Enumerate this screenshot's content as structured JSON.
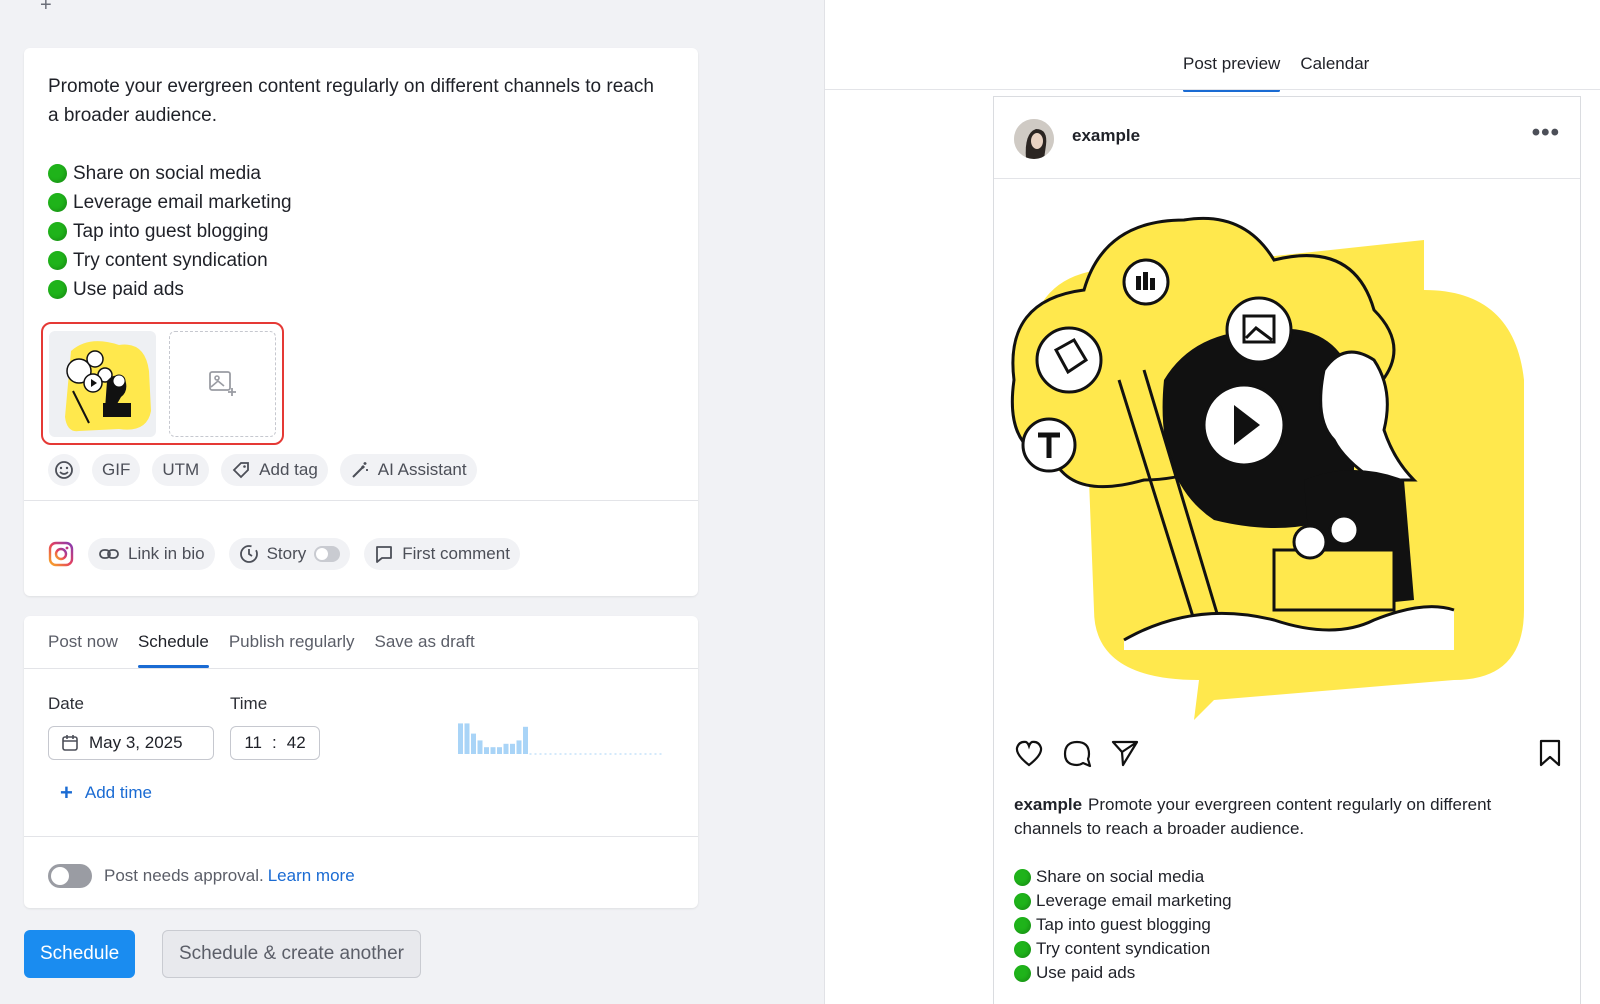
{
  "composer": {
    "intro": "Promote your evergreen content regularly on different channels to reach a broader audience.",
    "bullets": [
      "Share on social media",
      "Leverage email marketing",
      "Tap into guest blogging",
      "Try content syndication",
      "Use paid ads"
    ],
    "toolbar": {
      "gif": "GIF",
      "utm": "UTM",
      "add_tag": "Add tag",
      "ai_assistant": "AI Assistant"
    },
    "instagram_options": {
      "link_in_bio": "Link in bio",
      "story": "Story",
      "first_comment": "First comment"
    }
  },
  "schedule": {
    "tabs": [
      "Post now",
      "Schedule",
      "Publish regularly",
      "Save as draft"
    ],
    "active_tab": "Schedule",
    "date_label": "Date",
    "time_label": "Time",
    "date_value": "May 3, 2025",
    "time_hours": "11",
    "time_sep": ":",
    "time_minutes": "42",
    "add_time": "Add time",
    "approval_text": "Post needs approval.",
    "learn_more": "Learn more",
    "activity_bars": [
      0.9,
      0.9,
      0.6,
      0.4,
      0.2,
      0.2,
      0.2,
      0.3,
      0.3,
      0.4,
      0.8
    ]
  },
  "buttons": {
    "schedule": "Schedule",
    "schedule_another": "Schedule & create another"
  },
  "preview": {
    "tabs": [
      "Post preview",
      "Calendar"
    ],
    "active_tab": "Post preview",
    "username": "example",
    "more": "•••",
    "caption_intro": "Promote your evergreen content regularly on different channels to reach a broader audience."
  },
  "colors": {
    "accent": "#1a6bd3",
    "primary_button": "#1a8cf0",
    "highlight": "#e53935",
    "illustration_yellow": "#ffe84d",
    "bullet_green": "#1fb31a"
  }
}
